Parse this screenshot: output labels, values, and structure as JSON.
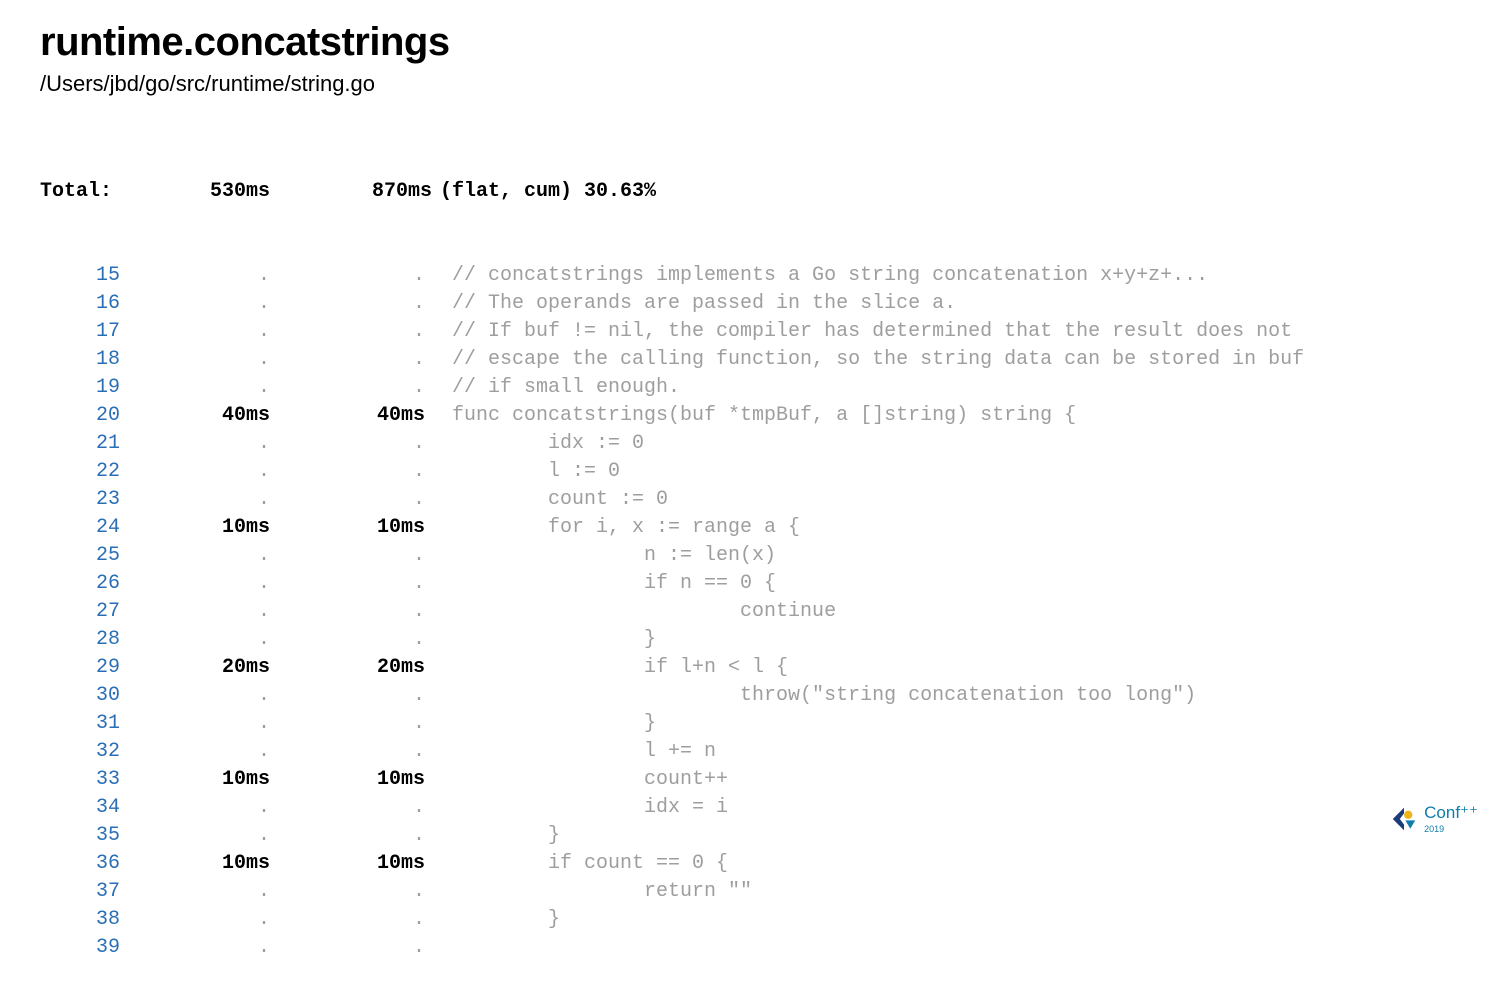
{
  "title": "runtime.concatstrings",
  "subtitle": "/Users/jbd/go/src/runtime/string.go",
  "header": {
    "label": "Total:",
    "flat": "530ms",
    "cum": "870ms",
    "summary": "(flat, cum) 30.63%"
  },
  "lines": [
    {
      "n": "15",
      "flat": ".",
      "cum": ".",
      "code": " // concatstrings implements a Go string concatenation x+y+z+..."
    },
    {
      "n": "16",
      "flat": ".",
      "cum": ".",
      "code": " // The operands are passed in the slice a."
    },
    {
      "n": "17",
      "flat": ".",
      "cum": ".",
      "code": " // If buf != nil, the compiler has determined that the result does not"
    },
    {
      "n": "18",
      "flat": ".",
      "cum": ".",
      "code": " // escape the calling function, so the string data can be stored in buf"
    },
    {
      "n": "19",
      "flat": ".",
      "cum": ".",
      "code": " // if small enough."
    },
    {
      "n": "20",
      "flat": "40ms",
      "cum": "40ms",
      "code": " func concatstrings(buf *tmpBuf, a []string) string {"
    },
    {
      "n": "21",
      "flat": ".",
      "cum": ".",
      "code": "         idx := 0"
    },
    {
      "n": "22",
      "flat": ".",
      "cum": ".",
      "code": "         l := 0"
    },
    {
      "n": "23",
      "flat": ".",
      "cum": ".",
      "code": "         count := 0"
    },
    {
      "n": "24",
      "flat": "10ms",
      "cum": "10ms",
      "code": "         for i, x := range a {"
    },
    {
      "n": "25",
      "flat": ".",
      "cum": ".",
      "code": "                 n := len(x)"
    },
    {
      "n": "26",
      "flat": ".",
      "cum": ".",
      "code": "                 if n == 0 {"
    },
    {
      "n": "27",
      "flat": ".",
      "cum": ".",
      "code": "                         continue"
    },
    {
      "n": "28",
      "flat": ".",
      "cum": ".",
      "code": "                 }"
    },
    {
      "n": "29",
      "flat": "20ms",
      "cum": "20ms",
      "code": "                 if l+n < l {"
    },
    {
      "n": "30",
      "flat": ".",
      "cum": ".",
      "code": "                         throw(\"string concatenation too long\")"
    },
    {
      "n": "31",
      "flat": ".",
      "cum": ".",
      "code": "                 }"
    },
    {
      "n": "32",
      "flat": ".",
      "cum": ".",
      "code": "                 l += n"
    },
    {
      "n": "33",
      "flat": "10ms",
      "cum": "10ms",
      "code": "                 count++"
    },
    {
      "n": "34",
      "flat": ".",
      "cum": ".",
      "code": "                 idx = i"
    },
    {
      "n": "35",
      "flat": ".",
      "cum": ".",
      "code": "         }"
    },
    {
      "n": "36",
      "flat": "10ms",
      "cum": "10ms",
      "code": "         if count == 0 {"
    },
    {
      "n": "37",
      "flat": ".",
      "cum": ".",
      "code": "                 return \"\""
    },
    {
      "n": "38",
      "flat": ".",
      "cum": ".",
      "code": "         }"
    },
    {
      "n": "39",
      "flat": ".",
      "cum": ".",
      "code": " "
    }
  ],
  "badge": {
    "text": "Conf⁺⁺",
    "year": "2019"
  }
}
